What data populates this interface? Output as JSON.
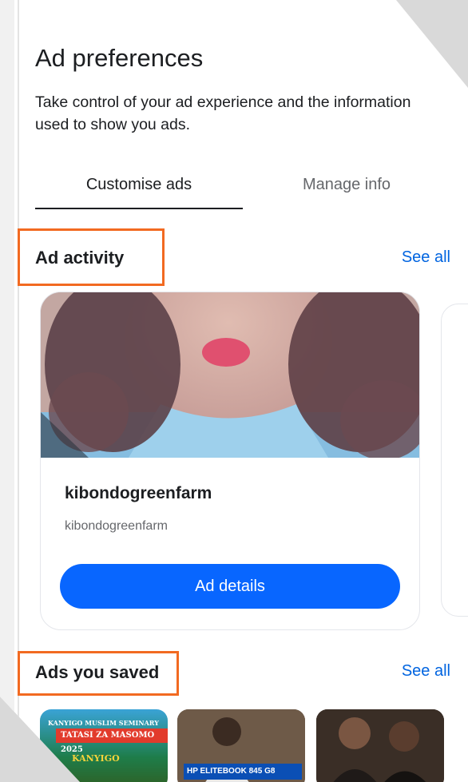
{
  "header": {
    "title": "Ad preferences",
    "subtitle": "Take control of your ad experience and the information used to show you ads."
  },
  "tabs": [
    {
      "label": "Customise ads",
      "active": true
    },
    {
      "label": "Manage info",
      "active": false
    }
  ],
  "ad_activity": {
    "title": "Ad activity",
    "see_all": "See all",
    "card": {
      "name": "kibondogreenfarm",
      "handle": "kibondogreenfarm",
      "button": "Ad details"
    }
  },
  "ads_saved": {
    "title": "Ads you saved",
    "see_all": "See all",
    "thumbs": [
      {
        "line1": "KANYIGO MUSLIM SEMINARY",
        "line2": "TATASI ZA MASOMO 2025",
        "line3": "KANYIGO"
      },
      {
        "caption": "HP ELITEBOOK 845 G8"
      },
      {
        "caption": ""
      }
    ]
  },
  "colors": {
    "accent": "#0064e0",
    "button": "#0866ff",
    "highlight": "#f26a21",
    "text": "#1c1e21",
    "muted": "#65676b"
  }
}
